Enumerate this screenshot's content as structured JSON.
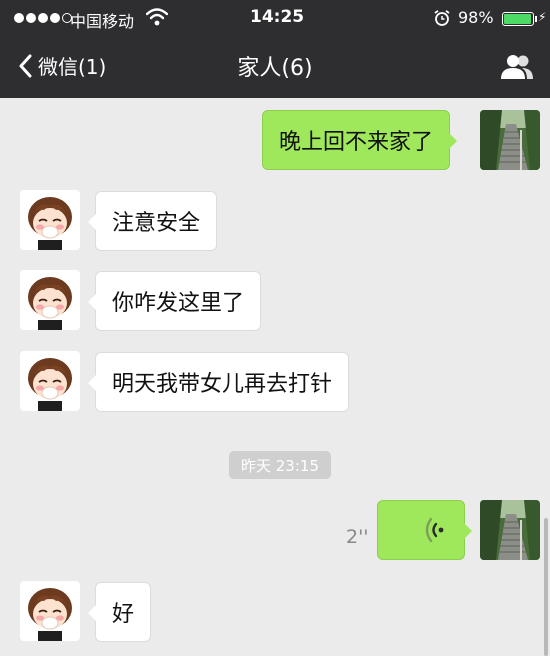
{
  "status_bar": {
    "carrier": "中国移动",
    "time": "14:25",
    "battery": "98%"
  },
  "nav": {
    "back_label": "微信(1)",
    "title": "家人(6)"
  },
  "messages": [
    {
      "side": "right",
      "type": "text",
      "text": "晚上回不来家了"
    },
    {
      "side": "left",
      "type": "text",
      "text": "注意安全"
    },
    {
      "side": "left",
      "type": "text",
      "text": "你咋发这里了"
    },
    {
      "side": "left",
      "type": "text",
      "text": "明天我带女儿再去打针"
    },
    {
      "type": "time",
      "text": "昨天 23:15"
    },
    {
      "side": "right",
      "type": "voice",
      "duration": "2''"
    },
    {
      "side": "left",
      "type": "text",
      "text": "好"
    }
  ],
  "colors": {
    "header_bg": "#2e2e31",
    "chat_bg": "#ebebeb",
    "sent_bubble": "#9fe75b",
    "received_bubble": "#ffffff"
  }
}
